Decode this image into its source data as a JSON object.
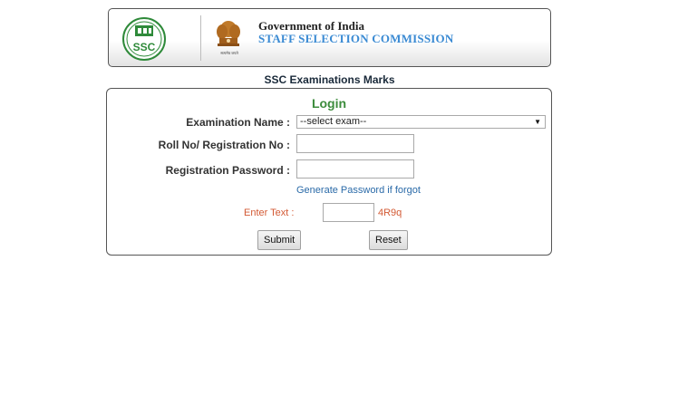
{
  "header": {
    "gov_title": "Government of India",
    "commission_title": "STAFF SELECTION COMMISSION",
    "logo_icon": "ssc-logo-icon",
    "emblem_icon": "national-emblem-icon",
    "emblem_caption": "सत्यमेव जयते"
  },
  "page": {
    "heading": "SSC Examinations Marks"
  },
  "login": {
    "title": "Login",
    "exam_label": "Examination Name :",
    "exam_selected": "--select exam--",
    "roll_label": "Roll No/ Registration No :",
    "roll_value": "",
    "password_label": "Registration Password :",
    "password_value": "",
    "forgot_link": "Generate Password if forgot",
    "captcha_label": "Enter Text :",
    "captcha_value": "",
    "captcha_code": "4R9q",
    "submit_label": "Submit",
    "reset_label": "Reset"
  },
  "colors": {
    "login_title": "#3c8c3c",
    "commission_title": "#3a8ad3",
    "captcha": "#d35a34",
    "link": "#2a6aa8"
  }
}
